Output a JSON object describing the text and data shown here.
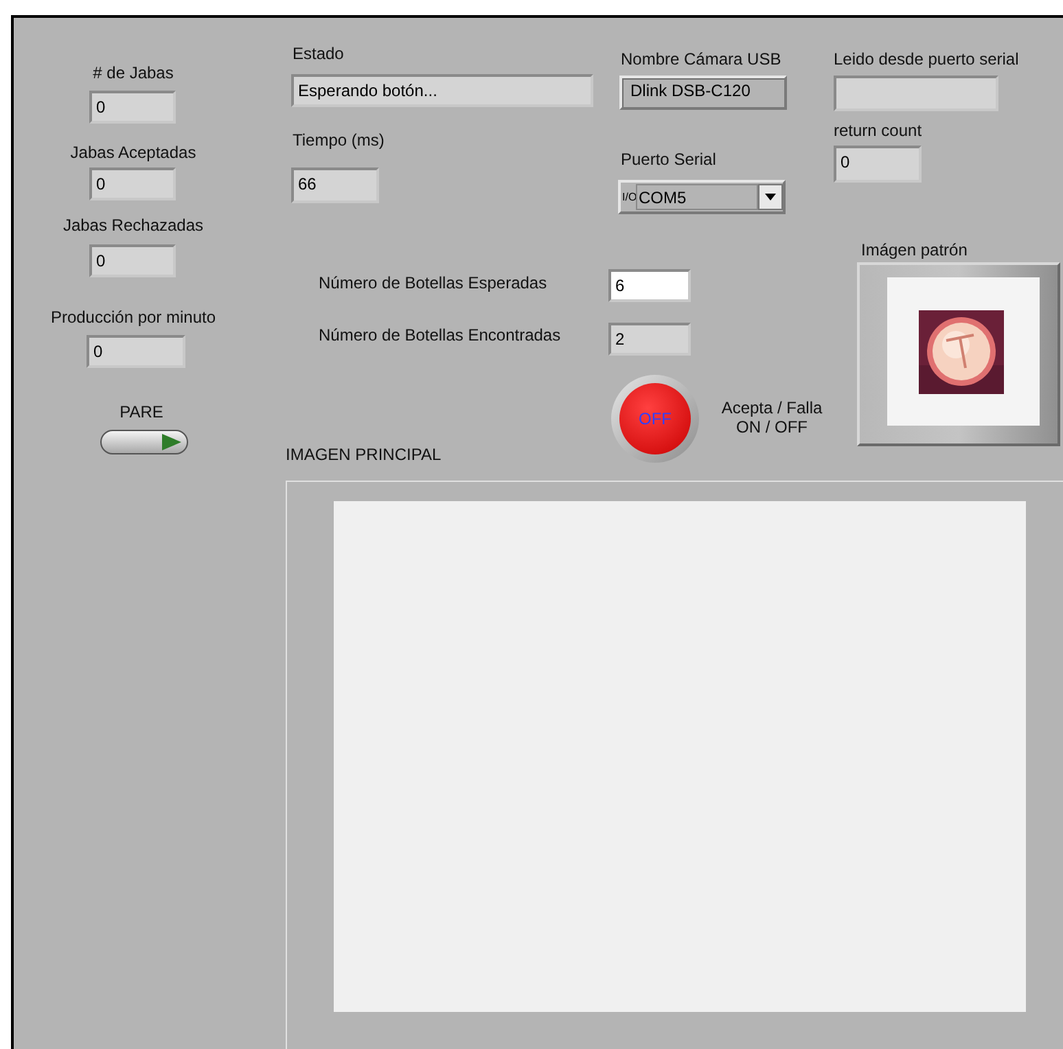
{
  "counters": [
    {
      "label": "# de Jabas",
      "value": "0"
    },
    {
      "label": "Jabas Aceptadas",
      "value": "0"
    },
    {
      "label": "Jabas Rechazadas",
      "value": "0"
    },
    {
      "label": "Producción por minuto",
      "value": "0"
    }
  ],
  "stop_button": {
    "label": "PARE",
    "on": false
  },
  "estado": {
    "label": "Estado",
    "value": "Esperando botón..."
  },
  "tiempo": {
    "label": "Tiempo (ms)",
    "value": "66"
  },
  "camera": {
    "label": "Nombre Cámara USB",
    "value": "Dlink DSB-C120"
  },
  "serial_read": {
    "label": "Leido desde puerto serial"
  },
  "return_count": {
    "label": "return count",
    "value": "0"
  },
  "serial_port": {
    "label": "Puerto Serial",
    "prefix": "I/O",
    "value": "COM5"
  },
  "bottles": [
    {
      "label": "Número de Botellas Esperadas",
      "value": "6",
      "kind": "control"
    },
    {
      "label": "Número de Botellas Encontradas",
      "value": "2",
      "kind": "indicator"
    }
  ],
  "accept_led": {
    "text": "OFF",
    "on": false,
    "caption": [
      "Acepta / Falla",
      "ON / OFF"
    ]
  },
  "pattern_image": {
    "label": "Imágen patrón",
    "kind": "picture"
  },
  "main_image": {
    "label": "IMAGEN PRINCIPAL"
  }
}
